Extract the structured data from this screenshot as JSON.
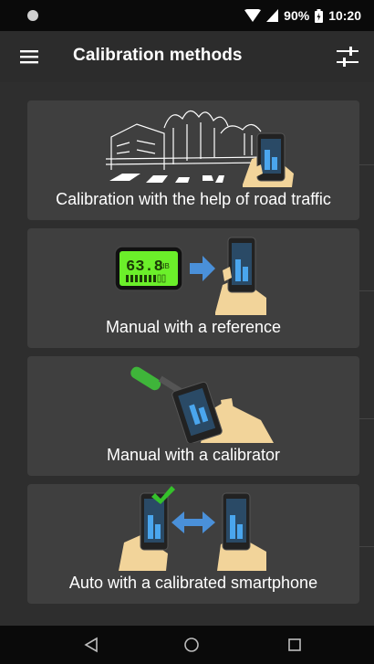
{
  "status_bar": {
    "battery": "90%",
    "time": "10:20"
  },
  "app_bar": {
    "title": "Calibration methods"
  },
  "cards": [
    {
      "label": "Calibration with the help of road traffic"
    },
    {
      "label": "Manual with a reference"
    },
    {
      "label": "Manual with a calibrator"
    },
    {
      "label": "Auto with a calibrated smartphone"
    }
  ],
  "illustrations": {
    "meter_reading": "63.8",
    "meter_unit": "dB"
  },
  "icons": {
    "menu": "hamburger-icon",
    "settings": "sliders-icon",
    "back": "back-triangle-icon",
    "home": "home-circle-icon",
    "recents": "recents-square-icon"
  },
  "colors": {
    "meter_green": "#6bef2a",
    "arrow_blue": "#4a90d9",
    "checkmark": "#35c12b"
  }
}
